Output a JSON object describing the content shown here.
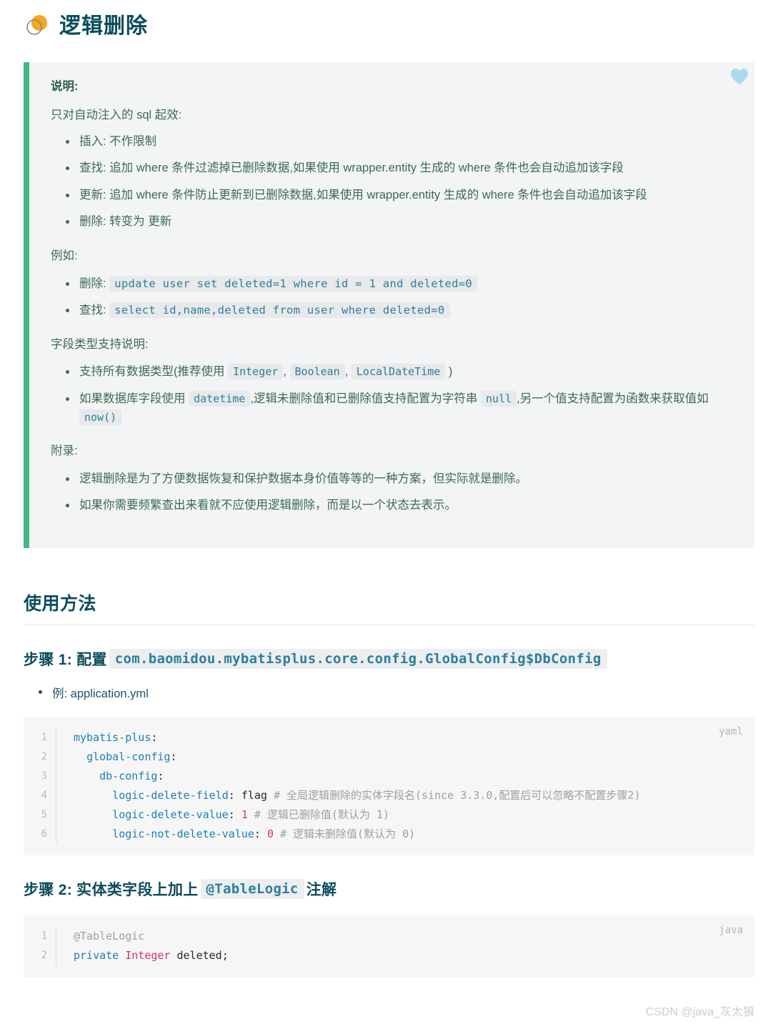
{
  "page": {
    "title": "逻辑删除",
    "title_icon": "orange-circle-ring-icon"
  },
  "callout": {
    "heading": "说明:",
    "intro": "只对自动注入的 sql 起效:",
    "behaviors": [
      "插入: 不作限制",
      "查找: 追加 where 条件过滤掉已删除数据,如果使用 wrapper.entity 生成的 where 条件也会自动追加该字段",
      "更新: 追加 where 条件防止更新到已删除数据,如果使用 wrapper.entity 生成的 where 条件也会自动追加该字段",
      "删除: 转变为 更新"
    ],
    "example_label": "例如:",
    "examples": [
      {
        "label": "删除:",
        "code": "update user set deleted=1 where id = 1 and deleted=0"
      },
      {
        "label": "查找:",
        "code": "select id,name,deleted from user where deleted=0"
      }
    ],
    "field_types_label": "字段类型支持说明:",
    "field_types": {
      "line1_prefix": "支持所有数据类型(推荐使用",
      "types": [
        "Integer",
        "Boolean",
        "LocalDateTime"
      ],
      "line1_suffix": ")",
      "line2_prefix": "如果数据库字段使用",
      "line2_code1": "datetime",
      "line2_mid": ",逻辑未删除值和已删除值支持配置为字符串",
      "line2_code2": "null",
      "line2_mid2": ",另一个值支持配置为函数来获取值如",
      "line2_code3": "now()"
    },
    "appendix_label": "附录:",
    "appendix": [
      "逻辑删除是为了方便数据恢复和保护数据本身价值等等的一种方案，但实际就是删除。",
      "如果你需要频繁查出来看就不应使用逻辑删除，而是以一个状态去表示。"
    ],
    "favorite_icon": "heart-icon"
  },
  "usage": {
    "heading": "使用方法",
    "step1": {
      "prefix": "步骤 1: 配置",
      "code": "com.baomidou.mybatisplus.core.config.GlobalConfig$DbConfig",
      "bullet": "例: application.yml"
    },
    "step2": {
      "prefix": "步骤 2: 实体类字段上加上",
      "code": "@TableLogic",
      "suffix": "注解"
    }
  },
  "code_yaml": {
    "lang": "yaml",
    "line_numbers": [
      "1",
      "2",
      "3",
      "4",
      "5",
      "6"
    ],
    "lines": [
      {
        "key": "mybatis-plus",
        "indent": 0,
        "value": "",
        "comment": ""
      },
      {
        "key": "global-config",
        "indent": 2,
        "value": "",
        "comment": ""
      },
      {
        "key": "db-config",
        "indent": 4,
        "value": "",
        "comment": ""
      },
      {
        "key": "logic-delete-field",
        "indent": 6,
        "value": "flag",
        "comment": "# 全局逻辑删除的实体字段名(since 3.3.0,配置后可以忽略不配置步骤2)"
      },
      {
        "key": "logic-delete-value",
        "indent": 6,
        "value": "1",
        "numeric": true,
        "comment": "# 逻辑已删除值(默认为 1)"
      },
      {
        "key": "logic-not-delete-value",
        "indent": 6,
        "value": "0",
        "numeric": true,
        "comment": "# 逻辑未删除值(默认为 0)"
      }
    ]
  },
  "code_java": {
    "lang": "java",
    "line_numbers": [
      "1",
      "2"
    ],
    "lines": [
      {
        "annotation": "@TableLogic"
      },
      {
        "keyword": "private",
        "type": "Integer",
        "rest": " deleted;"
      }
    ]
  },
  "watermark": "CSDN @java_灰太狼",
  "colors": {
    "accent_green": "#42b983",
    "heading_teal": "#0d4d5c",
    "callout_bg": "#f3f4f5",
    "code_bg": "#f6f6f6",
    "code_key_blue": "#1a7fb5",
    "code_num_pink": "#d6336c",
    "heart_blue": "#a8dcec"
  }
}
